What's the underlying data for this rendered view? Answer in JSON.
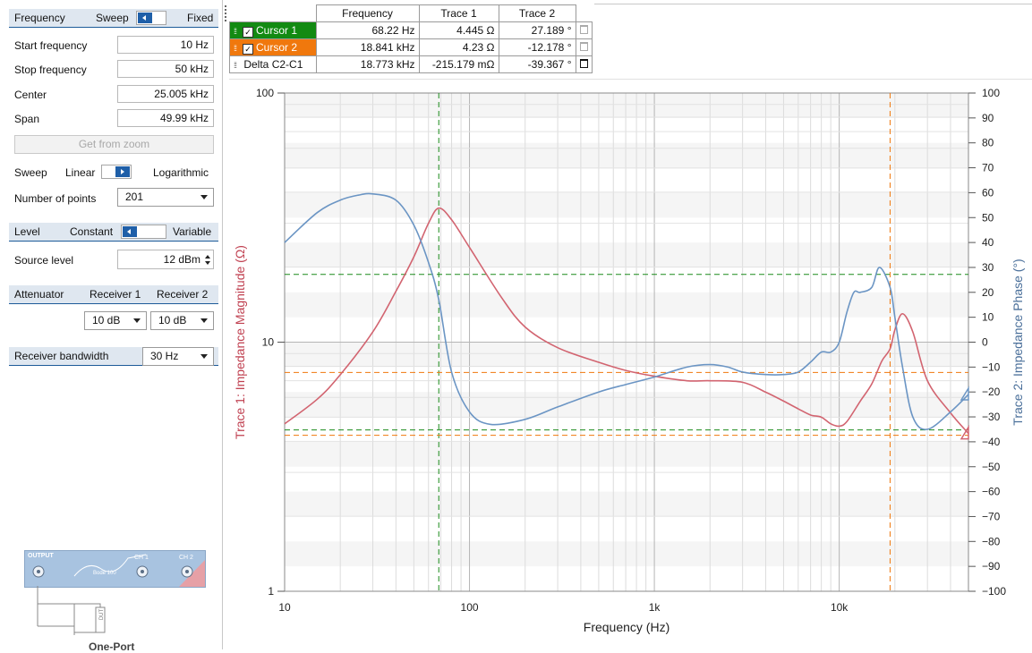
{
  "left_panel": {
    "frequency_header": {
      "title": "Frequency",
      "sweep_label": "Sweep",
      "fixed_label": "Fixed"
    },
    "start_frequency": {
      "label": "Start frequency",
      "value": "10 Hz"
    },
    "stop_frequency": {
      "label": "Stop frequency",
      "value": "50 kHz"
    },
    "center": {
      "label": "Center",
      "value": "25.005 kHz"
    },
    "span": {
      "label": "Span",
      "value": "49.99 kHz"
    },
    "get_from_zoom": "Get from zoom",
    "sweep": {
      "label": "Sweep",
      "linear": "Linear",
      "logarithmic": "Logarithmic"
    },
    "number_of_points": {
      "label": "Number of points",
      "value": "201"
    },
    "level_header": {
      "title": "Level",
      "constant": "Constant",
      "variable": "Variable"
    },
    "source_level": {
      "label": "Source level",
      "value": "12 dBm"
    },
    "attenuator": {
      "title": "Attenuator",
      "receiver1": "Receiver 1",
      "receiver2": "Receiver 2",
      "r1_value": "10 dB",
      "r2_value": "10 dB"
    },
    "receiver_bandwidth": {
      "label": "Receiver bandwidth",
      "value": "30 Hz"
    },
    "device": {
      "output": "OUTPUT",
      "ch1": "CH 1",
      "ch2": "CH 2",
      "model": "Bode 100",
      "dut": "DUT",
      "mode": "One-Port"
    }
  },
  "cursor_table": {
    "headers": [
      "Frequency",
      "Trace 1",
      "Trace 2"
    ],
    "rows": [
      {
        "name": "Cursor 1",
        "frequency": "68.22 Hz",
        "trace1": "4.445 Ω",
        "trace2": "27.189 °"
      },
      {
        "name": "Cursor 2",
        "frequency": "18.841 kHz",
        "trace1": "4.23 Ω",
        "trace2": "-12.178 °"
      },
      {
        "name": "Delta C2-C1",
        "frequency": "18.773 kHz",
        "trace1": "-215.179 mΩ",
        "trace2": "-39.367 °"
      }
    ]
  },
  "chart_data": {
    "type": "line",
    "xlabel": "Frequency (Hz)",
    "ylabel_left": "Trace 1: Impedance Magnitude (Ω)",
    "ylabel_right": "Trace 2: Impedance Phase (°)",
    "x_scale": "log",
    "xlim": [
      10,
      50000
    ],
    "ylim_left": [
      1,
      100
    ],
    "ylim_right": [
      -100,
      100
    ],
    "x_ticks": [
      {
        "v": 10,
        "label": "10"
      },
      {
        "v": 100,
        "label": "100"
      },
      {
        "v": 1000,
        "label": "1k"
      },
      {
        "v": 10000,
        "label": "10k"
      }
    ],
    "y_left_ticks": [
      {
        "v": 1,
        "label": "1"
      },
      {
        "v": 10,
        "label": "10"
      },
      {
        "v": 100,
        "label": "100"
      }
    ],
    "y_right_ticks": [
      100,
      90,
      80,
      70,
      60,
      50,
      40,
      30,
      20,
      10,
      0,
      -10,
      -20,
      -30,
      -40,
      -50,
      -60,
      -70,
      -80,
      -90,
      -100
    ],
    "grid": true,
    "colors": {
      "trace1": "#d26470",
      "trace2": "#6b95c4",
      "cursor1": "#1a8a1a",
      "cursor2": "#f0780d"
    },
    "series": [
      {
        "name": "Trace 1",
        "axis": "left",
        "x": [
          10,
          15,
          20,
          30,
          40,
          50,
          60,
          68.22,
          80,
          100,
          150,
          200,
          300,
          500,
          700,
          1000,
          1500,
          2000,
          3000,
          4000,
          5000,
          6000,
          7000,
          8000,
          9000,
          10000,
          11000,
          13000,
          15000,
          17000,
          18841,
          20000,
          22000,
          25000,
          30000,
          40000,
          50000
        ],
        "y": [
          4.7,
          5.9,
          7.4,
          11,
          16,
          22,
          30,
          34.5,
          31,
          24,
          15,
          11.5,
          9.5,
          8.3,
          7.7,
          7.3,
          7.0,
          7.0,
          6.9,
          6.3,
          5.8,
          5.4,
          5.1,
          5.0,
          4.7,
          4.6,
          4.8,
          5.8,
          6.8,
          8.4,
          9.4,
          11.2,
          13,
          11,
          7,
          5.2,
          4.3
        ]
      },
      {
        "name": "Trace 2",
        "axis": "right",
        "x": [
          10,
          15,
          20,
          25,
          30,
          40,
          50,
          60,
          68.22,
          80,
          100,
          130,
          200,
          300,
          500,
          700,
          1000,
          1500,
          2000,
          2500,
          3000,
          4000,
          5000,
          6000,
          7000,
          8000,
          9000,
          10000,
          11000,
          12000,
          13000,
          15000,
          16500,
          18841,
          20000,
          22000,
          25000,
          30000,
          40000,
          50000
        ],
        "y": [
          40,
          52,
          57,
          59,
          59.5,
          57,
          47,
          32,
          17,
          -12,
          -28,
          -33,
          -31,
          -26,
          -20,
          -17,
          -14,
          -10,
          -9,
          -10,
          -12,
          -13,
          -13,
          -12,
          -8,
          -4,
          -4,
          0,
          12,
          20,
          20,
          22,
          30,
          22,
          10,
          -10,
          -30,
          -35,
          -28,
          -21
        ]
      }
    ],
    "cursors": [
      {
        "name": "Cursor 1",
        "x": 68.22,
        "trace1": 4.445,
        "trace2": 27.189
      },
      {
        "name": "Cursor 2",
        "x": 18841,
        "trace1": 4.23,
        "trace2": -12.178
      }
    ]
  }
}
